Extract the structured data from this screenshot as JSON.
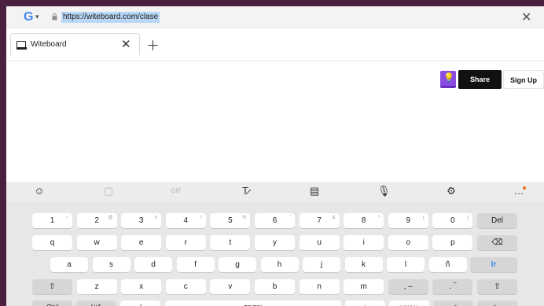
{
  "browser": {
    "url": "https://witeboard.com/clase",
    "search_engine": "G"
  },
  "tabs": [
    {
      "label": "Witeboard"
    }
  ],
  "header": {
    "share_label": "Share",
    "signup_label": "Sign Up"
  },
  "keyboard": {
    "toolbar": [
      "emoji-icon",
      "sticker-icon",
      "gif-icon",
      "handwriting-icon",
      "clipboard-icon",
      "mic-icon",
      "settings-icon",
      "more-icon"
    ],
    "rows": [
      [
        {
          "k": "1",
          "s": "~"
        },
        {
          "k": "2",
          "s": "@"
        },
        {
          "k": "3",
          "s": "#"
        },
        {
          "k": "4",
          "s": "/"
        },
        {
          "k": "5",
          "s": "%"
        },
        {
          "k": "6",
          "s": "'"
        },
        {
          "k": "7",
          "s": "&"
        },
        {
          "k": "8",
          "s": "*"
        },
        {
          "k": "9",
          "s": "("
        },
        {
          "k": "0",
          "s": ")"
        },
        {
          "k": "Del",
          "s": ""
        }
      ],
      [
        {
          "k": "q"
        },
        {
          "k": "w"
        },
        {
          "k": "e"
        },
        {
          "k": "r"
        },
        {
          "k": "t"
        },
        {
          "k": "y"
        },
        {
          "k": "u"
        },
        {
          "k": "i"
        },
        {
          "k": "o"
        },
        {
          "k": "p"
        },
        {
          "k": "⌫"
        }
      ],
      [
        {
          "k": "a"
        },
        {
          "k": "s"
        },
        {
          "k": "d"
        },
        {
          "k": "f"
        },
        {
          "k": "g"
        },
        {
          "k": "h"
        },
        {
          "k": "j"
        },
        {
          "k": "k"
        },
        {
          "k": "l"
        },
        {
          "k": "ñ"
        },
        {
          "k": "Ir"
        }
      ],
      [
        {
          "k": "⇧"
        },
        {
          "k": "z"
        },
        {
          "k": "x"
        },
        {
          "k": "c"
        },
        {
          "k": "v"
        },
        {
          "k": "b"
        },
        {
          "k": "n"
        },
        {
          "k": "m"
        },
        {
          "k": ", –"
        },
        {
          "k": ". ‾"
        },
        {
          "k": "⇧"
        }
      ],
      [
        {
          "k": "Ctrl"
        },
        {
          "k": "!#1"
        },
        {
          "k": "/"
        },
        {
          "k": "ES(ES)"
        },
        {
          "k": ";"
        },
        {
          "k": "www."
        },
        {
          "k": "◁"
        },
        {
          "k": "▷"
        }
      ]
    ]
  }
}
